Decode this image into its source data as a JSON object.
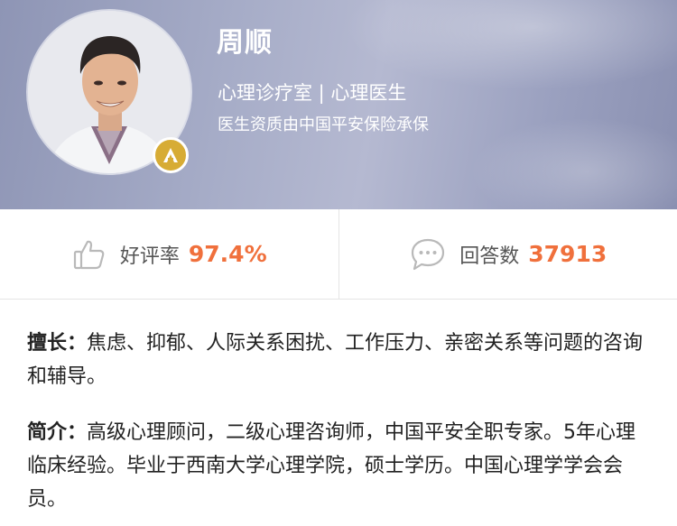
{
  "profile": {
    "name": "周顺",
    "title": "心理诊疗室 | 心理医生",
    "certification": "医生资质由中国平安保险承保",
    "badge_icon": "gold-a-badge-icon"
  },
  "stats": {
    "rating_label": "好评率",
    "rating_value": "97.4%",
    "answers_label": "回答数",
    "answers_value": "37913"
  },
  "expertise": {
    "label": "擅长：",
    "text": "焦虑、抑郁、人际关系困扰、工作压力、亲密关系等问题的咨询和辅导。"
  },
  "intro": {
    "label": "简介：",
    "text": "高级心理顾问，二级心理咨询师，中国平安全职专家。5年心理临床经验。毕业于西南大学心理学院，硕士学历。中国心理学学会会员。"
  },
  "colors": {
    "accent": "#f0703c",
    "badge": "#d7ac35",
    "header_bg": "#a7adc8"
  }
}
